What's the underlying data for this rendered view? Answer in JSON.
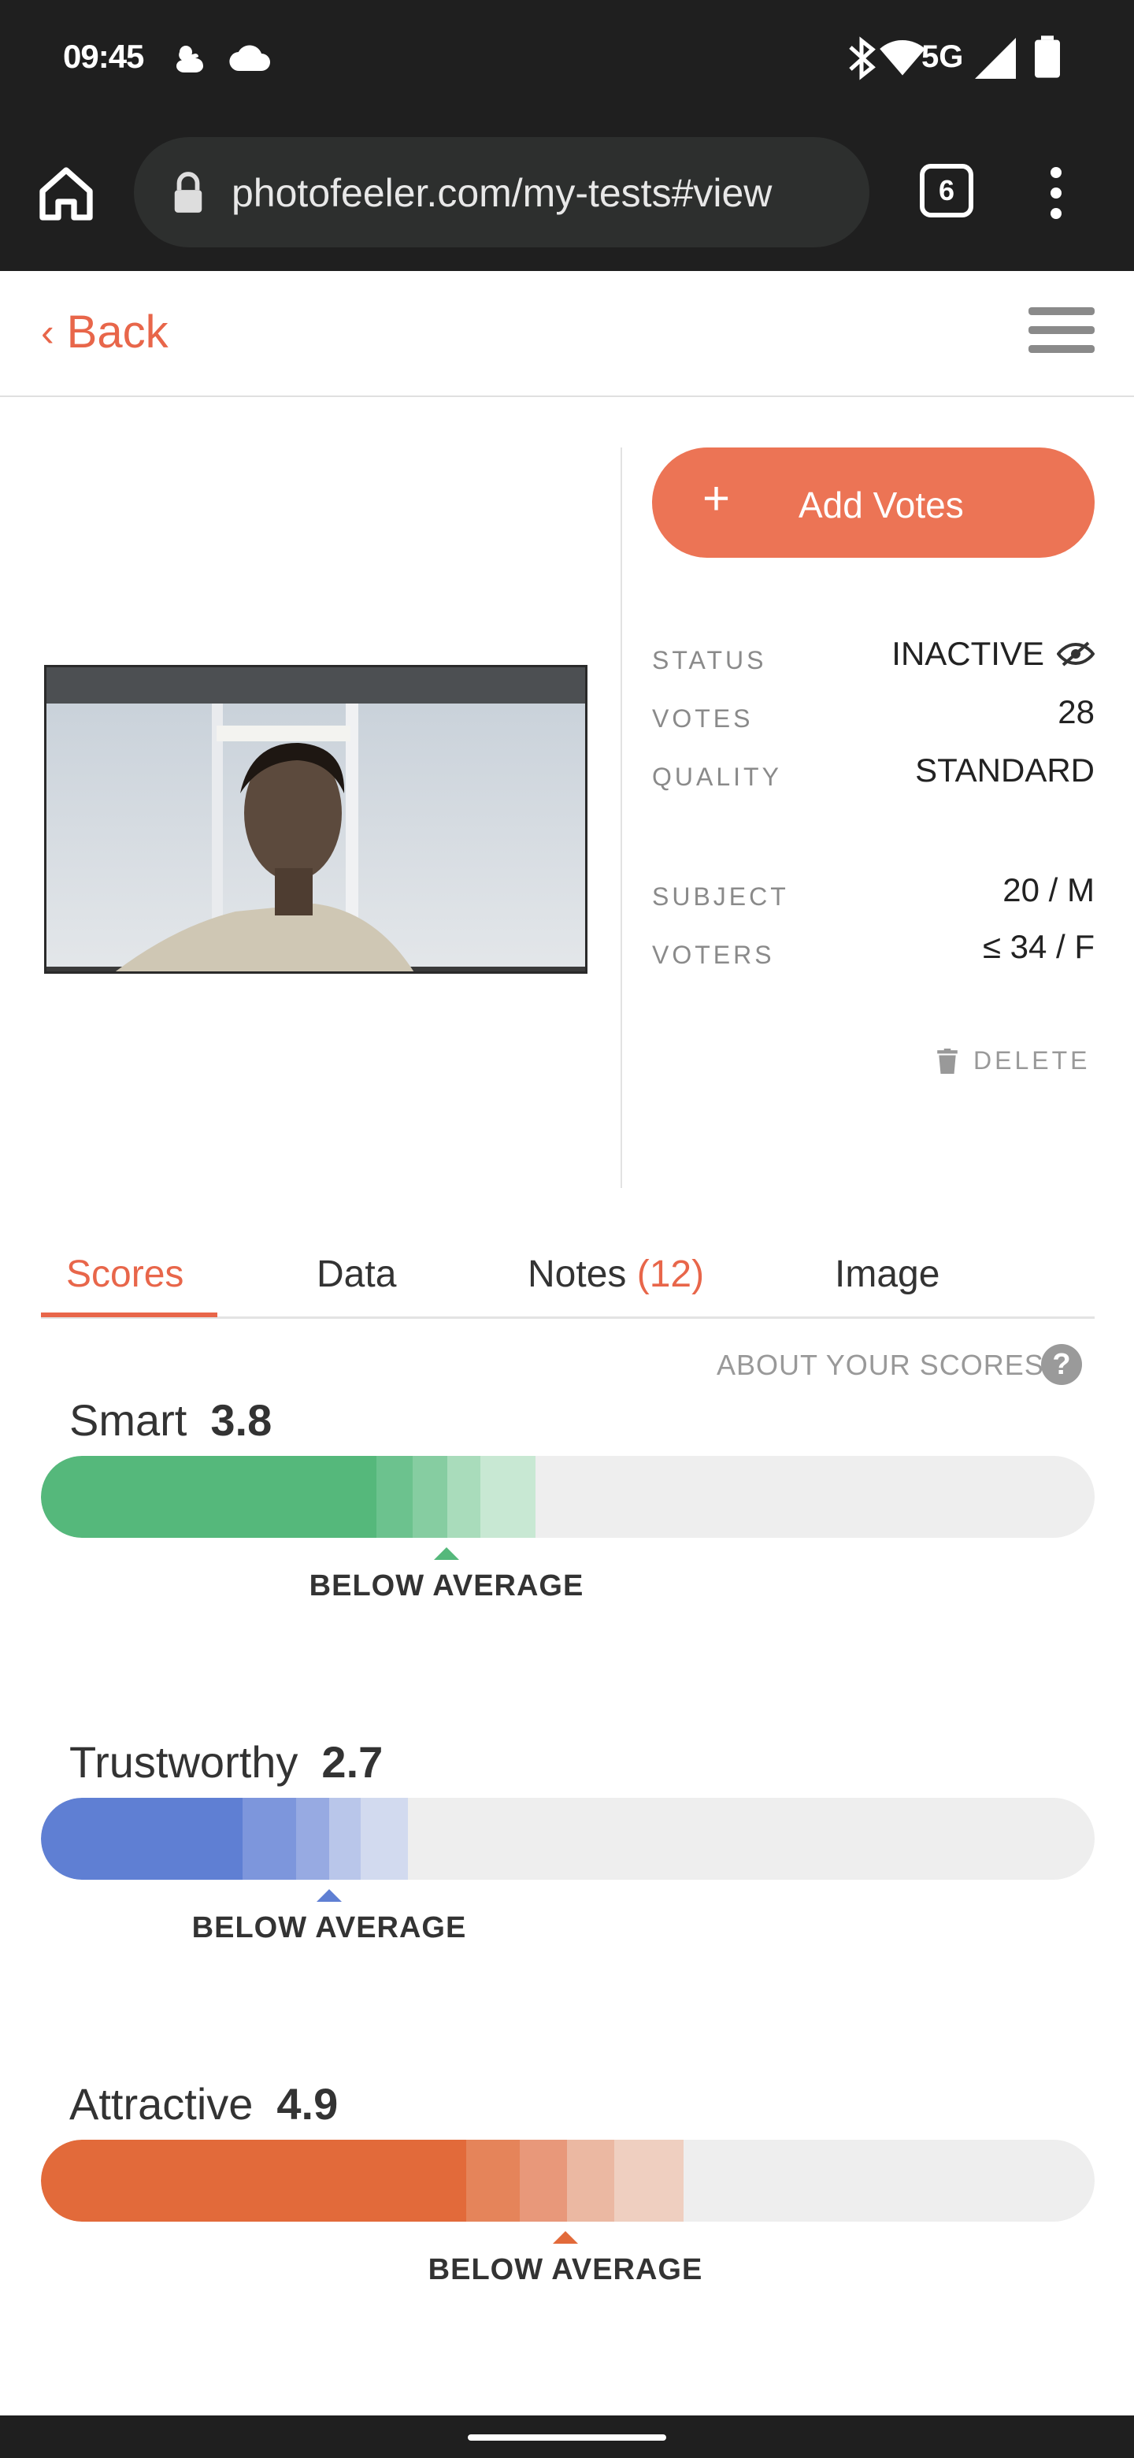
{
  "status_bar": {
    "time": "09:45",
    "network": "5G",
    "icons": [
      "duck-icon",
      "cloud-icon",
      "bluetooth-icon",
      "wifi-icon",
      "signal-icon",
      "battery-icon"
    ]
  },
  "browser": {
    "url": "photofeeler.com/my-tests#view",
    "tab_count": "6"
  },
  "header": {
    "back_label": "Back"
  },
  "photo": {
    "alt": "Test photo"
  },
  "panel": {
    "add_votes_label": "Add Votes",
    "status_label": "STATUS",
    "status_value": "INACTIVE",
    "votes_label": "VOTES",
    "votes_value": "28",
    "quality_label": "QUALITY",
    "quality_value": "STANDARD",
    "subject_label": "SUBJECT",
    "subject_value": "20 / M",
    "voters_label": "VOTERS",
    "voters_value": "≤ 34 / F",
    "delete_label": "DELETE"
  },
  "tabs": [
    {
      "label": "Scores",
      "active": true
    },
    {
      "label": "Data",
      "active": false
    },
    {
      "label": "Notes",
      "count": "(12)",
      "active": false
    },
    {
      "label": "Image",
      "active": false
    }
  ],
  "about_label": "ABOUT YOUR SCORES",
  "scores": [
    {
      "label": "Smart",
      "value": "3.8",
      "rating": "BELOW AVERAGE",
      "color": "#55b87b",
      "marker_pct": 38.5
    },
    {
      "label": "Trustworthy",
      "value": "2.7",
      "rating": "BELOW AVERAGE",
      "color": "#5f7fd3",
      "marker_pct": 27.3
    },
    {
      "label": "Attractive",
      "value": "4.9",
      "rating": "BELOW AVERAGE",
      "color": "#e26a3a",
      "marker_pct": 49.8
    }
  ],
  "colors": {
    "accent": "#e8664a",
    "button": "#ec7455",
    "chrome": "#1f1f1f"
  }
}
